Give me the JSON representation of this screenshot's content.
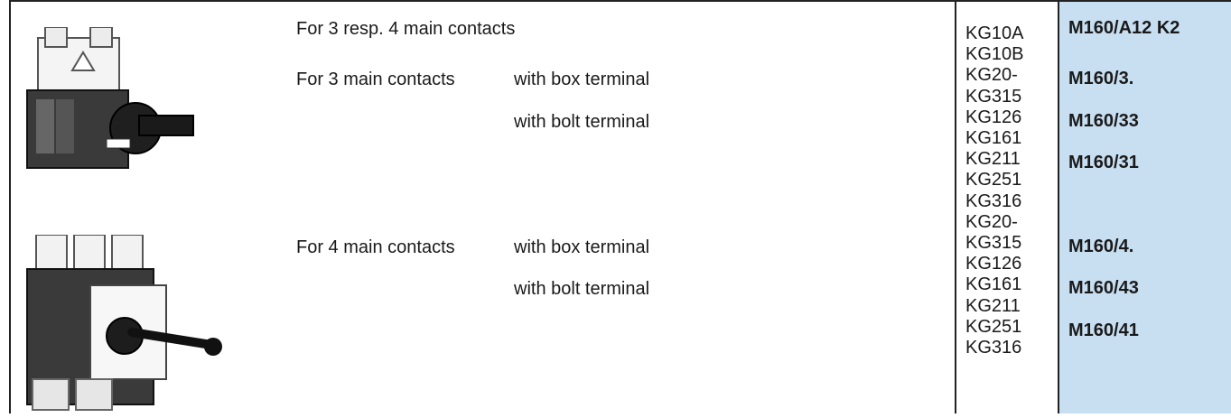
{
  "rows": {
    "r1_desc": "For 3 resp. 4 main contacts",
    "r2_desc": "For 3 main contacts",
    "r2_terminal": "with box terminal",
    "r3_terminal": "with bolt terminal",
    "r4_desc": "For 4 main contacts",
    "r4_terminal": "with box terminal",
    "r5_terminal": "with bolt terminal"
  },
  "kg_list": [
    "KG10A",
    "KG10B",
    "KG20-",
    "KG315",
    "KG126",
    "KG161",
    "KG211",
    "KG251",
    "KG316",
    "KG20-",
    "KG315",
    "KG126",
    "KG161",
    "KG211",
    "KG251",
    "KG316"
  ],
  "order_numbers": [
    "M160/A12 K2",
    "M160/3.",
    "M160/33",
    "M160/31",
    "M160/4.",
    "M160/43",
    "M160/41"
  ],
  "images": {
    "top": "switch-3-pole-icon",
    "bottom": "switch-4-pole-icon"
  },
  "colors": {
    "order_column": "#c8dff2"
  }
}
